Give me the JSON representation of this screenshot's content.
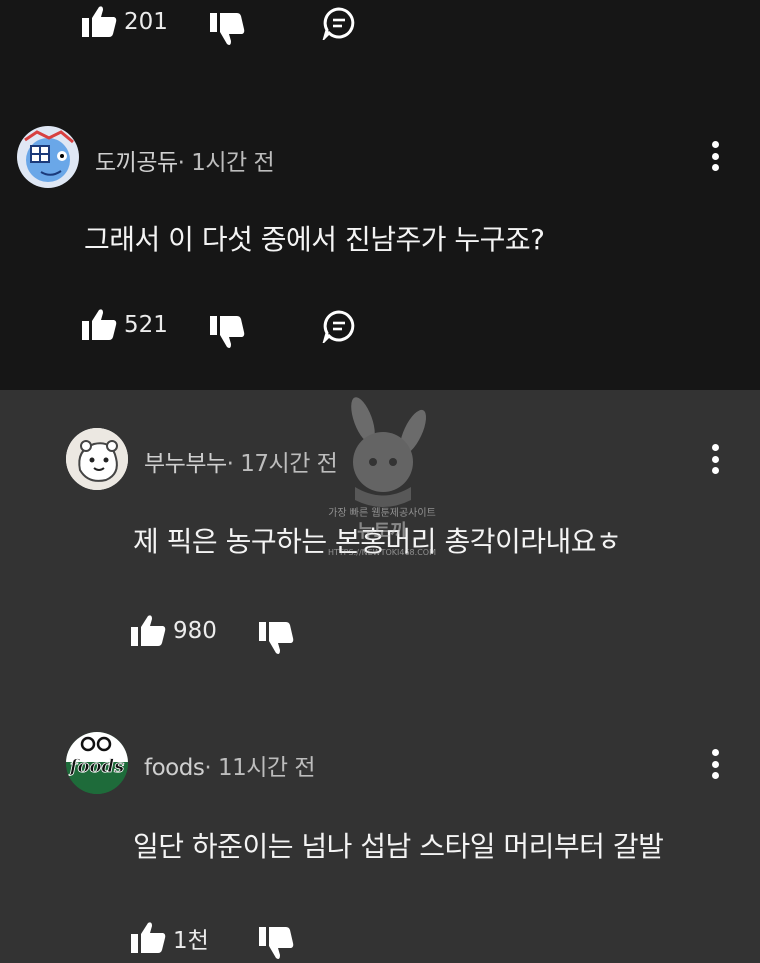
{
  "comments": [
    {
      "author": "",
      "time": "",
      "text": "",
      "likes": "201"
    },
    {
      "author": "도끼공듀",
      "time": "1시간 전",
      "text": "그래서 이 다섯 중에서 진남주가 누구죠?",
      "likes": "521"
    },
    {
      "author": "부누부누",
      "time": "17시간 전",
      "text": "제 픽은 농구하는 본홍머리 총각이라내요ㅎ",
      "likes": "980"
    },
    {
      "author": "foods",
      "time": "11시간 전",
      "text": "일단 하준이는 넘나 섭남 스타일 머리부터 갈발",
      "likes": "1천"
    }
  ],
  "watermark": {
    "line1": "가장 빠른 웹툰제공사이트",
    "line2": "뉴토끼",
    "line3": "HTTPS://NEWTOKI468.COM"
  },
  "avatar3_label": "foods",
  "colors": {
    "top_bg": "#161616",
    "bottom_bg": "#333333"
  },
  "icons": [
    "thumbs-up-icon",
    "thumbs-down-icon",
    "reply-icon",
    "more-vertical-icon"
  ]
}
